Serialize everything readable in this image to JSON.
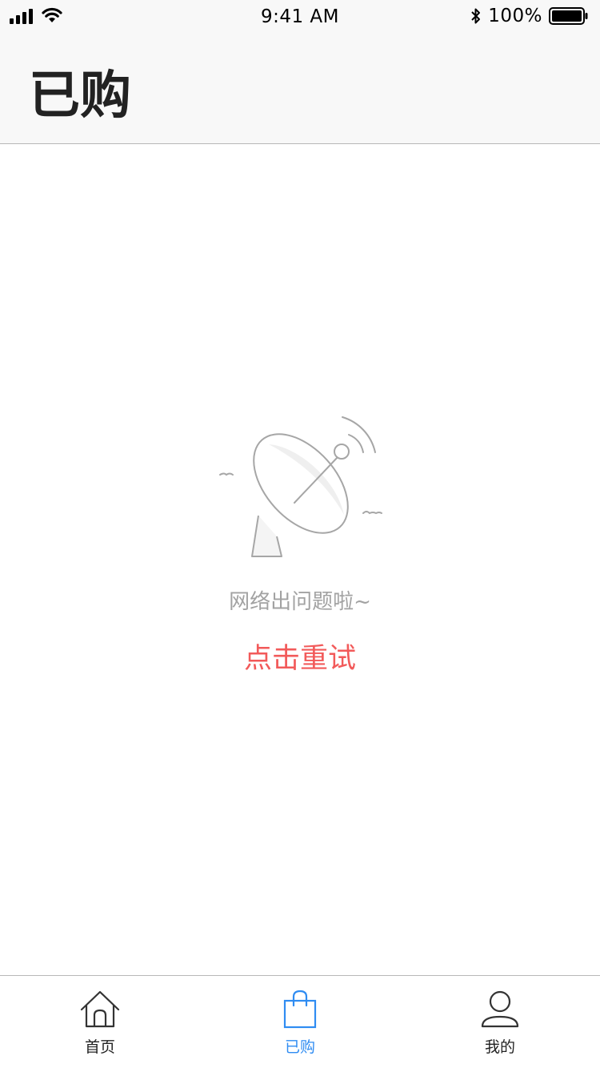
{
  "status_bar": {
    "time": "9:41 AM",
    "battery": "100%"
  },
  "header": {
    "title": "已购"
  },
  "main": {
    "error_message": "网络出问题啦~",
    "retry_label": "点击重试",
    "illustration_icon": "satellite-dish-icon"
  },
  "tabbar": {
    "active_index": 1,
    "items": [
      {
        "label": "首页",
        "icon": "home-icon"
      },
      {
        "label": "已购",
        "icon": "shopping-bag-icon"
      },
      {
        "label": "我的",
        "icon": "user-icon"
      }
    ]
  },
  "colors": {
    "accent": "#2f8cf2",
    "retry": "#f25a5a",
    "muted_text": "#a2a2a2",
    "title_text": "#222222",
    "header_bg": "#f8f8f8",
    "divider": "#b8b8b8"
  }
}
